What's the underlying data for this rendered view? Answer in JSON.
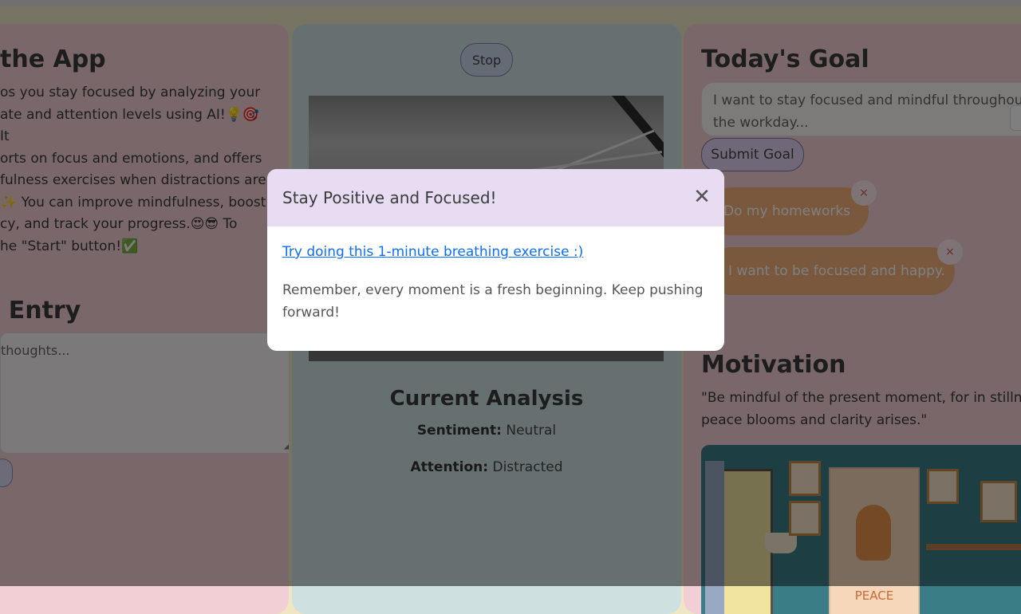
{
  "about": {
    "title": "the App",
    "text": "os you stay focused by analyzing your\nate and attention levels using AI!💡🎯 It\norts on focus and emotions, and offers\nfulness exercises when distractions are\n✨ You can improve mindfulness, boost\ncy, and track your progress.😍😎 To\nhe \"Start\" button!✅"
  },
  "journal": {
    "title": "l Entry",
    "placeholder": "thoughts..."
  },
  "camera": {
    "stop_label": "Stop"
  },
  "analysis": {
    "title": "Current Analysis",
    "sentiment_label": "Sentiment:",
    "sentiment_value": "Neutral",
    "attention_label": "Attention:",
    "attention_value": "Distracted"
  },
  "goal": {
    "title": "Today's Goal",
    "input_value": "I want to stay focused and mindful throughout the workday...",
    "submit_label": "Submit Goal",
    "items": [
      {
        "text": "Do my homeworks",
        "remove": "×"
      },
      {
        "text": "I want to be focused and happy.",
        "remove": "×"
      }
    ]
  },
  "motivation": {
    "title": "Motivation",
    "quote": "\"Be mindful of the present moment, for in stillness peace blooms and clarity arises.\"",
    "image_text": "PEACE"
  },
  "modal": {
    "title": "Stay Positive and Focused!",
    "close": "✕",
    "link": "Try doing this 1-minute breathing exercise :)",
    "message": "Remember, every moment is a fresh beginning. Keep pushing forward!"
  },
  "colors": {
    "left_panel": "#f2cfd4",
    "middle_panel": "#cfe0e1",
    "right_panel": "#f2cfd4",
    "modal_header": "#e8dcf3",
    "link": "#0d6efd",
    "goal_pill": "#f3b07a"
  }
}
